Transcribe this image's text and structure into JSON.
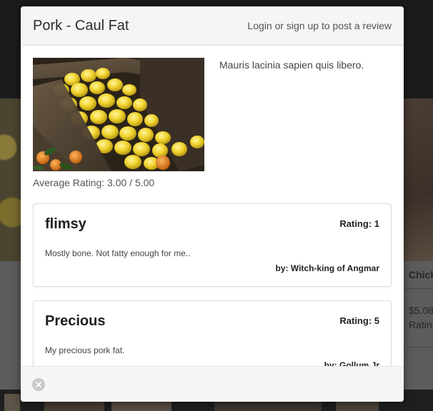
{
  "modal": {
    "title": "Pork - Caul Fat",
    "login_link": "Login or sign up to post a review",
    "product": {
      "image_icon": "lemons-in-crate-photo",
      "description": "Mauris lacinia sapien quis libero.",
      "average_rating": "Average Rating: 3.00 / 5.00"
    },
    "reviews": [
      {
        "title": "flimsy",
        "rating": "Rating: 1",
        "text": "Mostly bone. Not fatty enough for me..",
        "author": "by: Witch-king of Angmar"
      },
      {
        "title": "Precious",
        "rating": "Rating: 5",
        "text": "My precious pork fat.",
        "author": "by: Gollum Jr"
      }
    ],
    "footer": {
      "close_icon": "close-circle-icon"
    }
  },
  "background": {
    "card_fragment_title": "Chickh",
    "card_fragment_price": "$5.08",
    "card_fragment_rating": "Ratin"
  }
}
